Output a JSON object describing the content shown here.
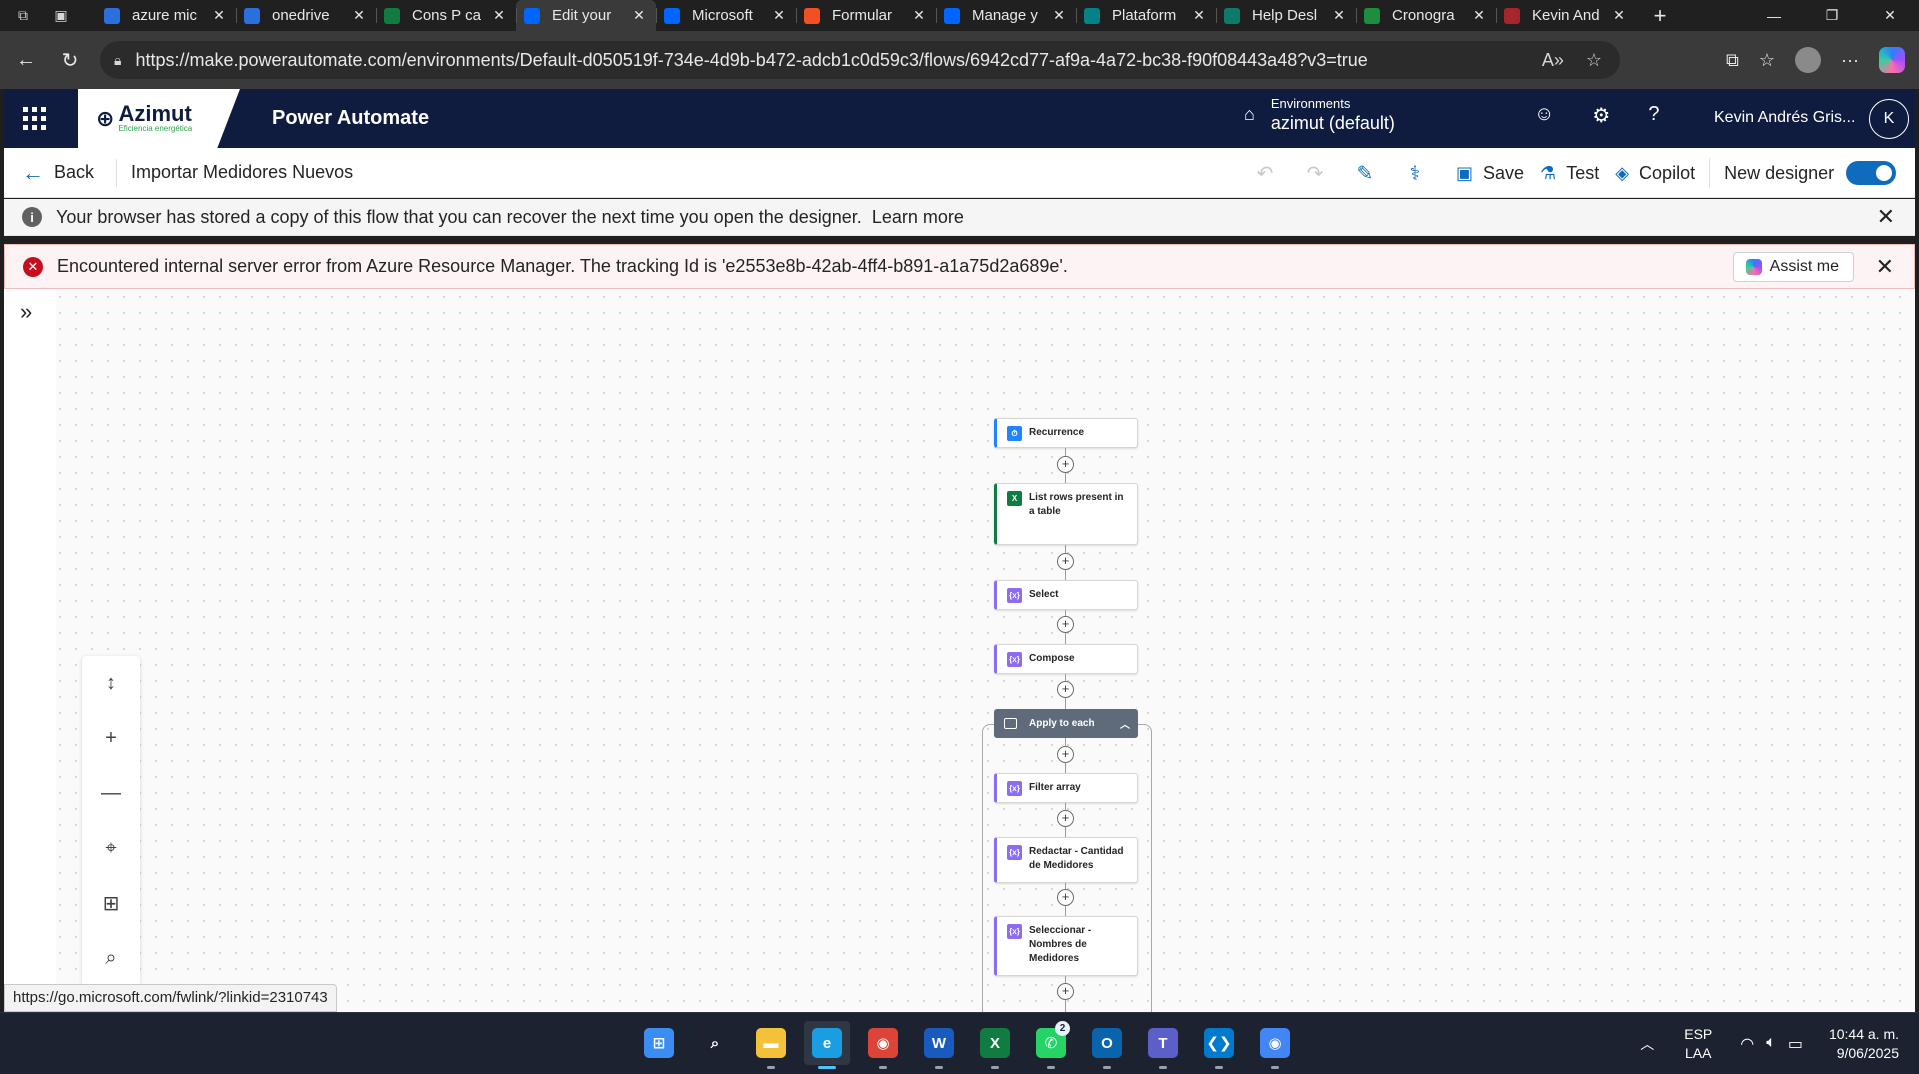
{
  "browser": {
    "tabs": [
      {
        "title": "azure mic",
        "icon": "search-icon",
        "color": "#2a6fdb"
      },
      {
        "title": "onedrive",
        "icon": "search-icon",
        "color": "#2a6fdb"
      },
      {
        "title": "Cons P ca",
        "icon": "excel-icon",
        "color": "#107c41"
      },
      {
        "title": "Edit your",
        "icon": "power-automate-icon",
        "color": "#0066ff",
        "active": true
      },
      {
        "title": "Microsoft",
        "icon": "power-automate-icon",
        "color": "#0066ff"
      },
      {
        "title": "Formular",
        "icon": "microsoft-icon",
        "color": "#f25022"
      },
      {
        "title": "Manage y",
        "icon": "power-automate-icon",
        "color": "#0066ff"
      },
      {
        "title": "Plataform",
        "icon": "sharepoint-icon",
        "color": "#038387"
      },
      {
        "title": "Help Desl",
        "icon": "help-desk-icon",
        "color": "#0e7a6b"
      },
      {
        "title": "Cronogra",
        "icon": "sheets-icon",
        "color": "#1e8e3e"
      },
      {
        "title": "Kevin And",
        "icon": "mail-icon",
        "color": "#a4262c"
      }
    ],
    "url": "https://make.powerautomate.com/environments/Default-d050519f-734e-4d9b-b472-adcb1c0d59c3/flows/6942cd77-af9a-4a72-bc38-f90f08443a48?v3=true"
  },
  "header": {
    "logo_name": "Azimut",
    "logo_tagline": "Eficiencia energética",
    "app_title": "Power Automate",
    "env_label": "Environments",
    "env_value": "azimut (default)",
    "user_name": "Kevin Andrés Gris...",
    "user_initial": "K"
  },
  "command_bar": {
    "back_label": "Back",
    "flow_name": "Importar Medidores Nuevos",
    "save_label": "Save",
    "test_label": "Test",
    "copilot_label": "Copilot",
    "new_designer_label": "New designer",
    "new_designer_on": true
  },
  "messages": {
    "info_text": "Your browser has stored a copy of this flow that you can recover the next time you open the designer.",
    "info_link": "Learn more",
    "error_text": "Encountered internal server error from Azure Resource Manager. The tracking Id is 'e2553e8b-42ab-4ff4-b891-a1a75d2a689e'.",
    "assist_label": "Assist me"
  },
  "flow": {
    "steps": [
      {
        "label": "Recurrence",
        "kind": "rec"
      },
      {
        "label": "List rows present in a table",
        "kind": "xl"
      },
      {
        "label": "Select",
        "kind": "op"
      },
      {
        "label": "Compose",
        "kind": "op"
      }
    ],
    "loop_label": "Apply to each",
    "loop_steps": [
      {
        "label": "Filter array",
        "kind": "op"
      },
      {
        "label": "Redactar - Cantidad de Medidores",
        "kind": "op"
      },
      {
        "label": "Seleccionar - Nombres de Medidores",
        "kind": "op"
      }
    ]
  },
  "status_url": "https://go.microsoft.com/fwlink/?linkid=2310743",
  "taskbar": {
    "apps": [
      {
        "name": "windows-start-icon",
        "glyph": "⊞",
        "color": "#3b8ef0"
      },
      {
        "name": "search-icon",
        "glyph": "⌕",
        "color": "transparent"
      },
      {
        "name": "file-explorer-icon",
        "glyph": "▬",
        "color": "#f3c13a"
      },
      {
        "name": "edge-icon",
        "glyph": "e",
        "color": "#1b9de2",
        "active": true
      },
      {
        "name": "chrome-icon",
        "glyph": "◉",
        "color": "#db4437"
      },
      {
        "name": "word-icon",
        "glyph": "W",
        "color": "#185abd"
      },
      {
        "name": "excel-icon",
        "glyph": "X",
        "color": "#107c41"
      },
      {
        "name": "whatsapp-icon",
        "glyph": "✆",
        "color": "#25d366",
        "badge": "2"
      },
      {
        "name": "outlook-icon",
        "glyph": "O",
        "color": "#0a64ad"
      },
      {
        "name": "teams-icon",
        "glyph": "T",
        "color": "#5b5fc7"
      },
      {
        "name": "vscode-icon",
        "glyph": "❮❯",
        "color": "#007acc"
      },
      {
        "name": "chrome-profile-icon",
        "glyph": "◉",
        "color": "#4285f4"
      }
    ],
    "lang_top": "ESP",
    "lang_bottom": "LAA",
    "time": "10:44 a. m.",
    "date": "9/06/2025"
  }
}
